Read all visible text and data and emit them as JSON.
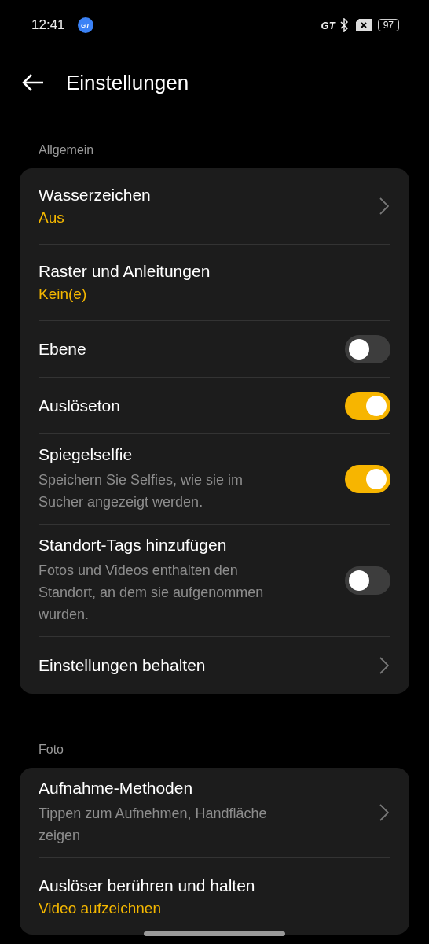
{
  "status_bar": {
    "time": "12:41",
    "app_badge": "GT",
    "brand_mark": "GT",
    "battery": "97"
  },
  "header": {
    "title": "Einstellungen"
  },
  "sections": [
    {
      "label": "Allgemein",
      "items": [
        {
          "kind": "link",
          "title": "Wasserzeichen",
          "value": "Aus",
          "chevron": true
        },
        {
          "kind": "link",
          "title": "Raster und Anleitungen",
          "value": "Kein(e)",
          "chevron": false
        },
        {
          "kind": "toggle",
          "title": "Ebene",
          "on": false
        },
        {
          "kind": "toggle",
          "title": "Auslöseton",
          "on": true
        },
        {
          "kind": "toggle",
          "title": "Spiegelselfie",
          "description": "Speichern Sie Selfies, wie sie im Sucher angezeigt werden.",
          "on": true
        },
        {
          "kind": "toggle",
          "title": "Standort-Tags hinzufügen",
          "description": "Fotos und Videos enthalten den Standort, an dem sie aufgenommen wurden.",
          "on": false
        },
        {
          "kind": "link",
          "title": "Einstellungen behalten",
          "chevron": true
        }
      ]
    },
    {
      "label": "Foto",
      "items": [
        {
          "kind": "link",
          "title": "Aufnahme-Methoden",
          "description": "Tippen zum Aufnehmen, Handfläche zeigen",
          "chevron": true
        },
        {
          "kind": "link",
          "title": "Auslöser berühren und halten",
          "value": "Video aufzeichnen",
          "chevron": false
        }
      ]
    }
  ]
}
